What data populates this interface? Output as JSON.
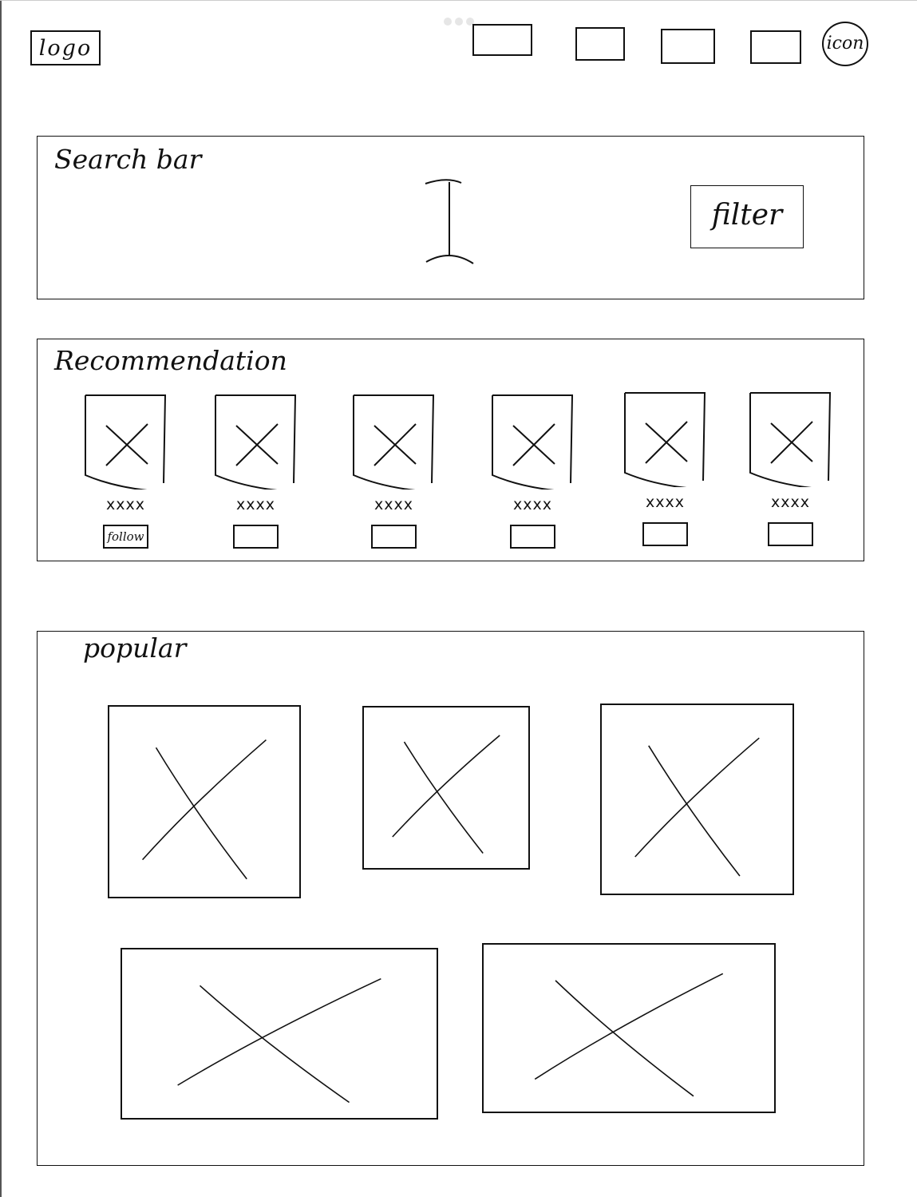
{
  "header": {
    "logo_text": "logo",
    "profile_text": "icon",
    "nav_items": [
      "",
      "",
      "",
      ""
    ]
  },
  "search": {
    "title": "Search bar",
    "filter_label": "filter"
  },
  "recommendation": {
    "title": "Recommendation",
    "items": [
      {
        "name": "xxxx",
        "button": "follow"
      },
      {
        "name": "xxxx",
        "button": ""
      },
      {
        "name": "xxxx",
        "button": ""
      },
      {
        "name": "xxxx",
        "button": ""
      },
      {
        "name": "xxxx",
        "button": ""
      },
      {
        "name": "xxxx",
        "button": ""
      }
    ]
  },
  "popular": {
    "title": "popular",
    "items": [
      "",
      "",
      "",
      "",
      ""
    ]
  }
}
